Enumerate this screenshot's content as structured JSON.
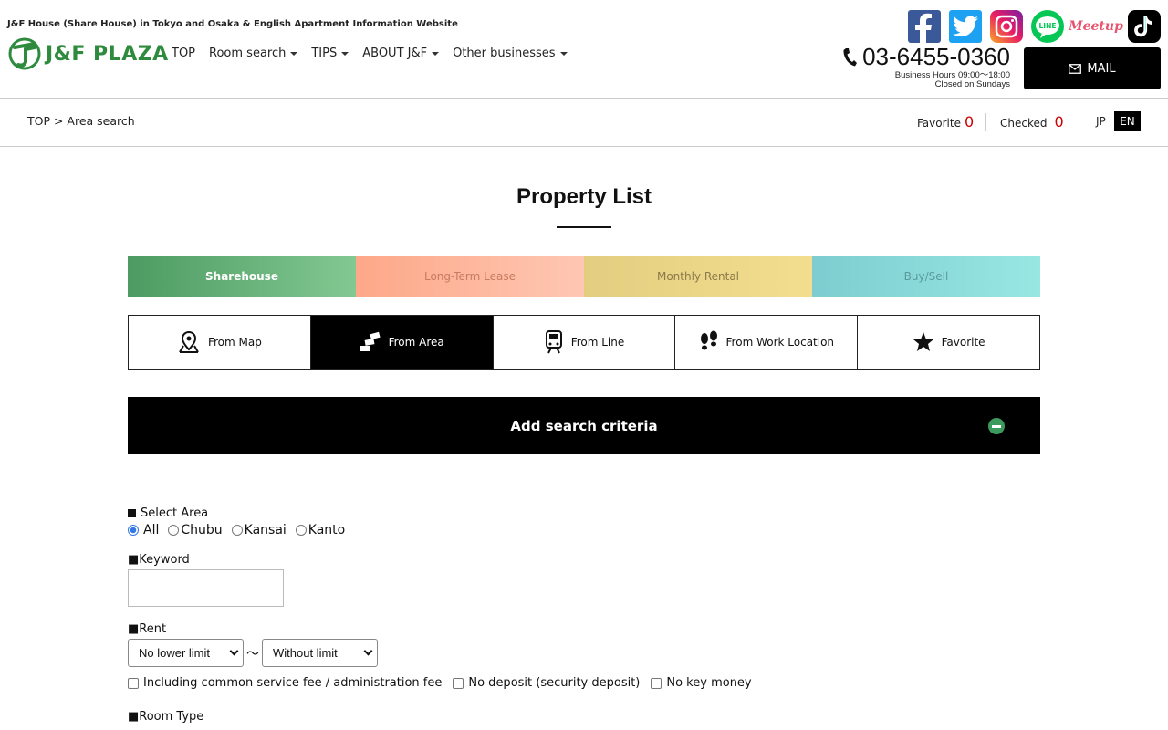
{
  "header": {
    "tagline": "J&F House (Share House) in Tokyo and Osaka & English Apartment Information Website",
    "logo_text": "J&F PLAZA",
    "nav": [
      {
        "label": "TOP",
        "dropdown": false
      },
      {
        "label": "Room search",
        "dropdown": true
      },
      {
        "label": "TIPS",
        "dropdown": true
      },
      {
        "label": "ABOUT J&F",
        "dropdown": true
      },
      {
        "label": "Other businesses",
        "dropdown": true
      }
    ],
    "social": [
      "facebook-icon",
      "twitter-icon",
      "instagram-icon",
      "line-icon",
      "meetup-icon",
      "tiktok-icon"
    ],
    "meetup_text": "Meetup",
    "line_text": "LINE",
    "phone": "03-6455-0360",
    "hours_line1": "Business Hours 09:00〜18:00",
    "hours_line2": "Closed on Sundays",
    "mail_label": "MAIL"
  },
  "subbar": {
    "breadcrumb": "TOP > Area search",
    "favorite_label": "Favorite",
    "favorite_count": "0",
    "checked_label": "Checked",
    "checked_count": "0",
    "lang_jp": "JP",
    "lang_en": "EN"
  },
  "main": {
    "title": "Property List",
    "categories": [
      "Sharehouse",
      "Long-Term Lease",
      "Monthly Rental",
      "Buy/Sell"
    ],
    "modes": [
      "From Map",
      "From Area",
      "From Line",
      "From Work Location",
      "Favorite"
    ],
    "active_mode": "From Area",
    "criteria_label": "Add search criteria"
  },
  "form": {
    "area_label": "Select Area",
    "area_options": [
      "All",
      "Chubu",
      "Kansai",
      "Kanto"
    ],
    "area_selected": "All",
    "keyword_label": "■Keyword",
    "keyword_value": "",
    "rent_label": "■Rent",
    "rent_min": "No lower limit",
    "rent_sep": "～",
    "rent_max": "Without limit",
    "checks": [
      "Including common service fee / administration fee",
      "No deposit (security deposit)",
      "No key money"
    ],
    "room_type_label": "■Room Type"
  },
  "colors": {
    "brand_green": "#2e8b3e",
    "favorite_red": "#cc0000"
  }
}
